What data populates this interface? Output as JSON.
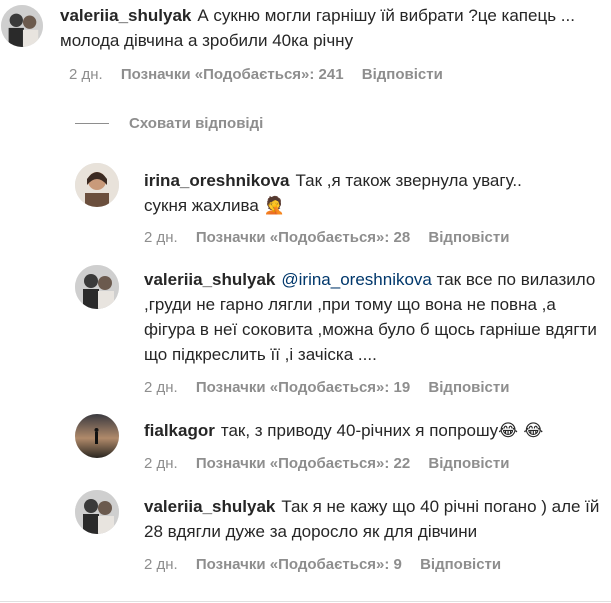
{
  "comments": [
    {
      "username": "valeriia_shulyak",
      "text": "А сукню могли гарнішу їй вибрати ?це капець ... молода дівчина а зробили 40ка річну",
      "time": "2 дн.",
      "likes": "Позначки «Подобається»: 241",
      "reply": "Відповісти"
    }
  ],
  "hide_replies_label": "Сховати відповіді",
  "replies": [
    {
      "username": "irina_oreshnikova",
      "text": "Так ,я також звернула увагу.. сукня жахлива",
      "emoji": "🤦",
      "time": "2 дн.",
      "likes": "Позначки «Подобається»: 28",
      "reply": "Відповісти"
    },
    {
      "username": "valeriia_shulyak",
      "mention": "@irina_oreshnikova",
      "text": "так все по вилазило ,груди не гарно лягли ,при тому що вона не повна ,а фігура в неї соковита ,можна було б щось гарніше вдягти що підкреслить її ,і зачіска ....",
      "time": "2 дн.",
      "likes": "Позначки «Подобається»: 19",
      "reply": "Відповісти"
    },
    {
      "username": "fialkagor",
      "text": "так, з приводу 40-річних я попрошу",
      "emoji": "😂 😂",
      "time": "2 дн.",
      "likes": "Позначки «Подобається»: 22",
      "reply": "Відповісти"
    },
    {
      "username": "valeriia_shulyak",
      "text": "Так я не кажу що 40 річні погано ) але їй 28 вдягли дуже за доросло як для дівчини",
      "time": "2 дн.",
      "likes": "Позначки «Подобається»: 9",
      "reply": "Відповісти"
    }
  ]
}
